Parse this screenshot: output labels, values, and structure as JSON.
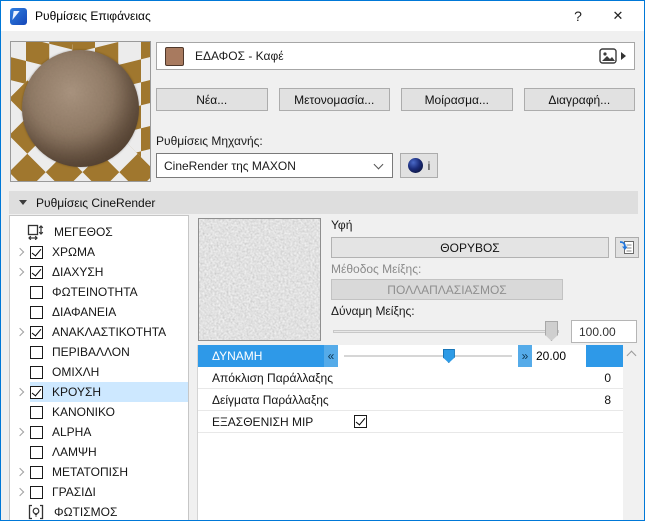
{
  "window": {
    "title": "Ρυθμίσεις Επιφάνειας",
    "help": "?",
    "close": "✕"
  },
  "material": {
    "name": "ΕΔΑΦΟΣ - Καφέ",
    "swatch_color": "#a87a5f"
  },
  "actions": {
    "new": "Νέα...",
    "rename": "Μετονομασία...",
    "share": "Μοίρασμα...",
    "delete": "Διαγραφή..."
  },
  "engine": {
    "label": "Ρυθμίσεις Μηχανής:",
    "selected": "CineRender της MAXON",
    "info": "i"
  },
  "section": {
    "title": "Ρυθμίσεις CineRender"
  },
  "channels": [
    {
      "label": "ΜΕΓΕΘΟΣ",
      "icon": "size",
      "expand": false,
      "checked": null,
      "selected": false
    },
    {
      "label": "ΧΡΩΜΑ",
      "icon": null,
      "expand": true,
      "checked": true,
      "selected": false
    },
    {
      "label": "ΔΙΑΧΥΣΗ",
      "icon": null,
      "expand": true,
      "checked": true,
      "selected": false
    },
    {
      "label": "ΦΩΤΕΙΝΟΤΗΤΑ",
      "icon": null,
      "expand": false,
      "checked": false,
      "selected": false
    },
    {
      "label": "ΔΙΑΦΑΝΕΙΑ",
      "icon": null,
      "expand": false,
      "checked": false,
      "selected": false
    },
    {
      "label": "ΑΝΑΚΛΑΣΤΙΚΟΤΗΤΑ",
      "icon": null,
      "expand": true,
      "checked": true,
      "selected": false
    },
    {
      "label": "ΠΕΡΙΒΑΛΛΟΝ",
      "icon": null,
      "expand": false,
      "checked": false,
      "selected": false
    },
    {
      "label": "ΟΜΙΧΛΗ",
      "icon": null,
      "expand": false,
      "checked": false,
      "selected": false
    },
    {
      "label": "ΚΡΟΥΣΗ",
      "icon": null,
      "expand": true,
      "checked": true,
      "selected": true
    },
    {
      "label": "ΚΑΝΟΝΙΚΟ",
      "icon": null,
      "expand": false,
      "checked": false,
      "selected": false
    },
    {
      "label": "ALPHA",
      "icon": null,
      "expand": true,
      "checked": false,
      "selected": false
    },
    {
      "label": "ΛΑΜΨΗ",
      "icon": null,
      "expand": false,
      "checked": false,
      "selected": false
    },
    {
      "label": "ΜΕΤΑΤΟΠΙΣΗ",
      "icon": null,
      "expand": true,
      "checked": false,
      "selected": false
    },
    {
      "label": "ΓΡΑΣΙΔΙ",
      "icon": null,
      "expand": true,
      "checked": false,
      "selected": false
    },
    {
      "label": "ΦΩΤΙΣΜΟΣ",
      "icon": "light",
      "expand": false,
      "checked": null,
      "selected": false
    }
  ],
  "texture_panel": {
    "texture_label": "Υφή",
    "texture_button": "ΘΟΡΥΒΟΣ",
    "mix_mode_label": "Μέθοδος Μείξης:",
    "mix_mode_value": "ΠΟΛΛΑΠΛΑΣΙΑΣΜΟΣ",
    "mix_strength_label": "Δύναμη Μείξης:",
    "mix_strength_value": "100.00",
    "mix_strength_percent": 100
  },
  "params": {
    "rows": [
      {
        "label": "ΔΥΝΑΜΗ",
        "control": "slider",
        "value": "20.00",
        "percent": 61,
        "selected": true,
        "dec_glyph": "«",
        "inc_glyph": "»"
      },
      {
        "label": "Απόκλιση Παράλλαξης",
        "control": "value",
        "value": "0",
        "selected": false
      },
      {
        "label": "Δείγματα Παράλλαξης",
        "control": "value",
        "value": "8",
        "selected": false
      },
      {
        "label": "ΕΞΑΣΘΕΝΙΣΗ MIP",
        "control": "checkbox",
        "checked": true,
        "selected": false
      }
    ]
  },
  "colors": {
    "accent_blue": "#2e99e8",
    "selection_blue": "#cde8ff",
    "window_border": "#0078d7",
    "swatch_brown": "#a87a5f"
  }
}
